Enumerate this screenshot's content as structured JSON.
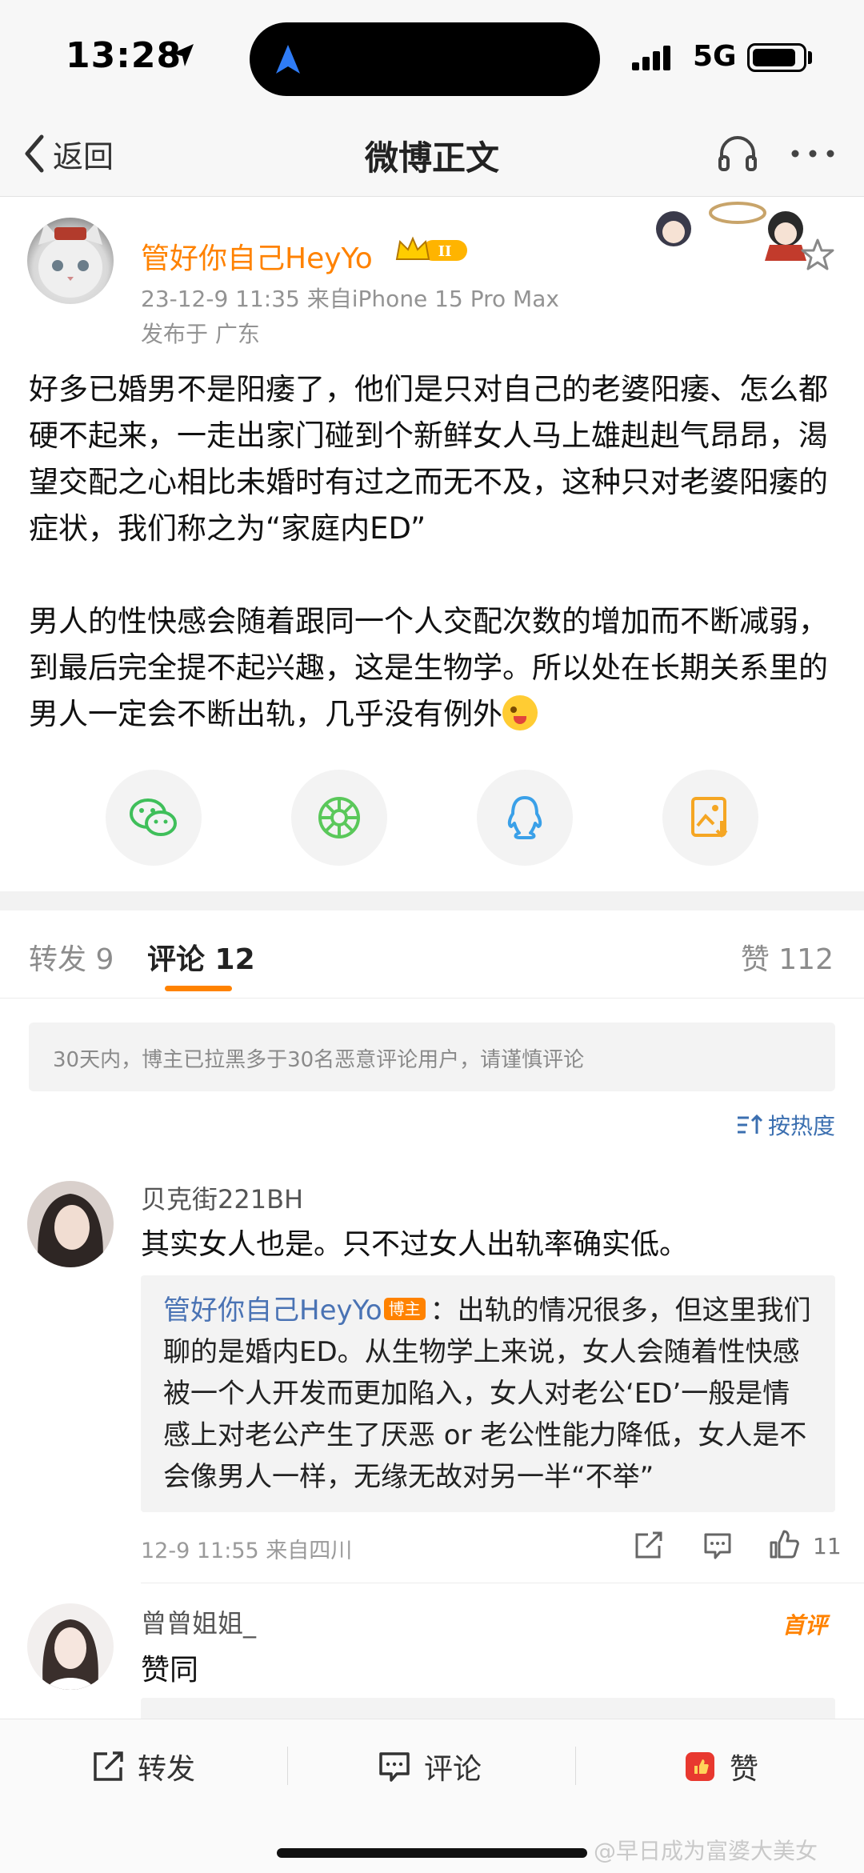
{
  "status_bar": {
    "time": "13:28",
    "network": "5G",
    "battery_level": 0.85
  },
  "nav": {
    "back_label": "返回",
    "title": "微博正文"
  },
  "post": {
    "author": "管好你自己HeyYo",
    "meta": "23-12-9 11:35  来自iPhone 15 Pro Max",
    "location": "发布于 广东",
    "paragraph_1": "好多已婚男不是阳痿了，他们是只对自己的老婆阳痿、怎么都硬不起来，一走出家门碰到个新鲜女人马上雄赳赳气昂昂，渴望交配之心相比未婚时有过之而无不及，这种只对老婆阳痿的症状，我们称之为“家庭内ED”",
    "paragraph_2": "男人的性快感会随着跟同一个人交配次数的增加而不断减弱，到最后完全提不起兴趣，这是生物学。所以处在长期关系里的男人一定会不断出轨，几乎没有例外",
    "share_icons": [
      "wechat-icon",
      "moments-icon",
      "qq-icon",
      "save-image-icon"
    ]
  },
  "tabs": {
    "repost": "转发 9",
    "comment": "评论 12",
    "like": "赞 112"
  },
  "notice": "30天内，博主已拉黑多于30名恶意评论用户，请谨慎评论",
  "sort_label": "按热度",
  "comments": [
    {
      "name": "贝克街221BH",
      "text": "其实女人也是。只不过女人出轨率确实低。",
      "reply": {
        "author": "管好你自己HeyYo",
        "tag": "博主",
        "text": "：出轨的情况很多，但这里我们聊的是婚内ED。从生物学上来说，女人会随着性快感被一个人开发而更加陷入，女人对老公‘ED’一般是情感上对老公产生了厌恶 or 老公性能力降低，女人是不会像男人一样，无缘无故对另一半“不举”"
      },
      "meta": "12-9 11:55  来自四川",
      "likes": "11"
    },
    {
      "name": "曾曾姐姐_",
      "text": "赞同",
      "badge": "首评"
    }
  ],
  "toolbar": {
    "repost": "转发",
    "comment": "评论",
    "like": "赞"
  },
  "watermark": "@早日成为富婆大美女",
  "colors": {
    "accent": "#ff8200",
    "link": "#4a73b4"
  }
}
